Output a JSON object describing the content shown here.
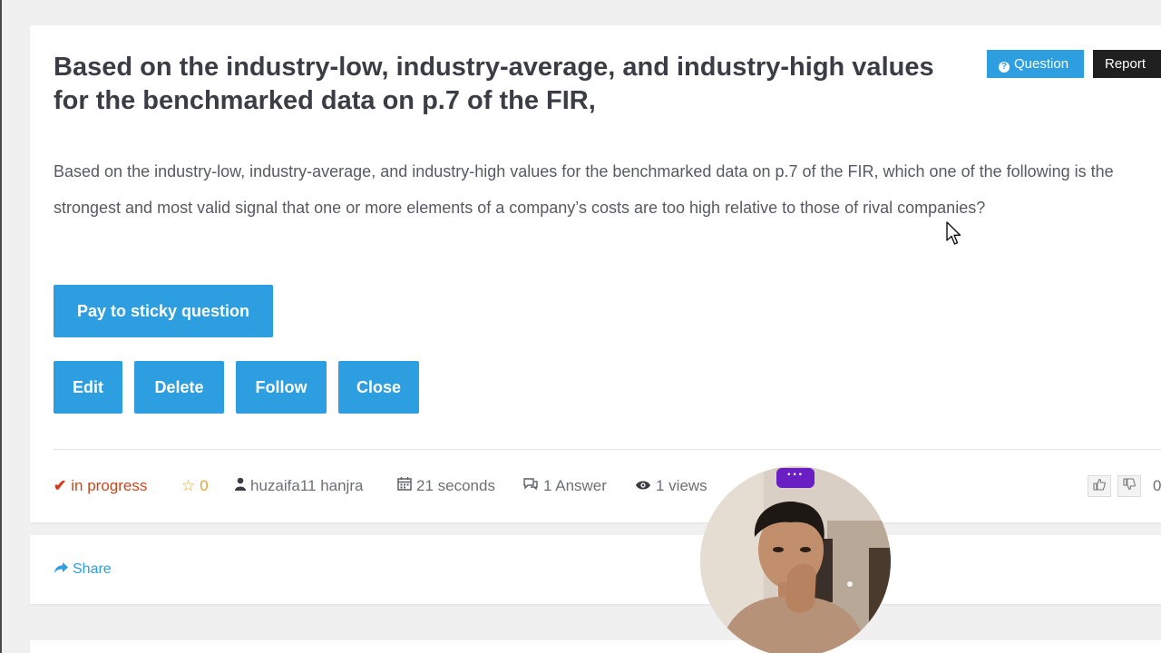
{
  "question": {
    "title": "Based on the industry-low, industry-average, and industry-high values for the benchmarked data on p.7 of the FIR,",
    "body": "Based on the industry-low, industry-average, and industry-high values for the benchmarked data on p.7 of the FIR, which one of the following is the strongest and most valid signal that one or more elements of a company’s costs are too high relative to those of rival companies?",
    "badge_question": "Question",
    "badge_report": "Report"
  },
  "actions": {
    "sticky": "Pay to sticky question",
    "edit": "Edit",
    "delete": "Delete",
    "follow": "Follow",
    "close": "Close"
  },
  "meta": {
    "status": "in progress",
    "stars": "0",
    "author": "huzaifa11 hanjra",
    "time": "21 seconds",
    "answers": "1 Answer",
    "views": "1 views",
    "votes": "0"
  },
  "share": {
    "label": "Share"
  },
  "webcam": {
    "menu": "···"
  },
  "colors": {
    "accent": "#2d9ee0",
    "status": "#c9481d",
    "star": "#e2a633",
    "report": "#202020"
  }
}
